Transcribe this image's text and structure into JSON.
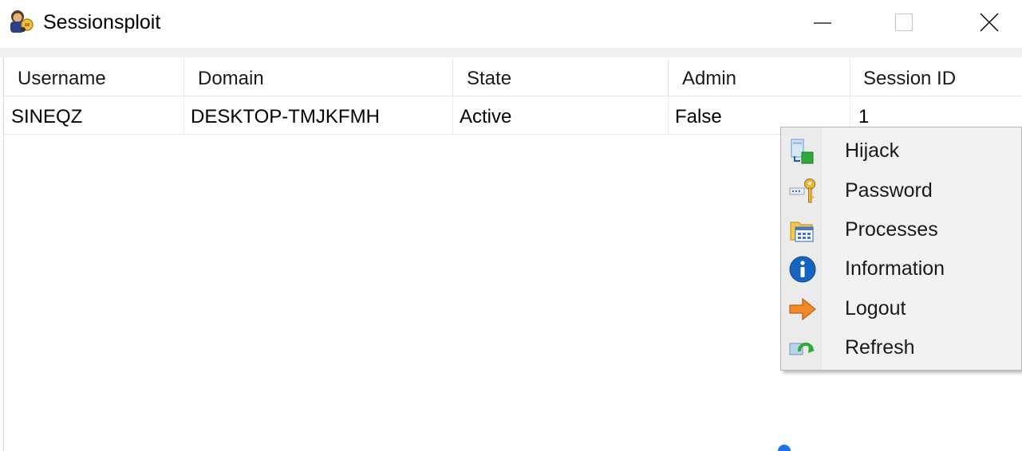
{
  "window": {
    "title": "Sessionsploit",
    "icon": "app-icon",
    "controls": {
      "minimize": "minimize-icon",
      "maximize": "maximize-icon",
      "close": "close-icon"
    }
  },
  "table": {
    "columns": [
      "Username",
      "Domain",
      "State",
      "Admin",
      "Session ID"
    ],
    "rows": [
      [
        "SINEQZ",
        "DESKTOP-TMJKFMH",
        "Active",
        "False",
        "1"
      ]
    ]
  },
  "context_menu": {
    "items": [
      {
        "label": "Hijack",
        "icon": "hijack-icon"
      },
      {
        "label": "Password",
        "icon": "password-key-icon"
      },
      {
        "label": "Processes",
        "icon": "processes-icon"
      },
      {
        "label": "Information",
        "icon": "information-icon"
      },
      {
        "label": "Logout",
        "icon": "logout-arrow-icon"
      },
      {
        "label": "Refresh",
        "icon": "refresh-icon"
      }
    ]
  },
  "colors": {
    "window_bg": "#ffffff",
    "menu_bg": "#f2f2f2",
    "info_blue": "#1565c0",
    "logout_orange": "#f0892a",
    "hijack_green": "#2eaa3a"
  }
}
